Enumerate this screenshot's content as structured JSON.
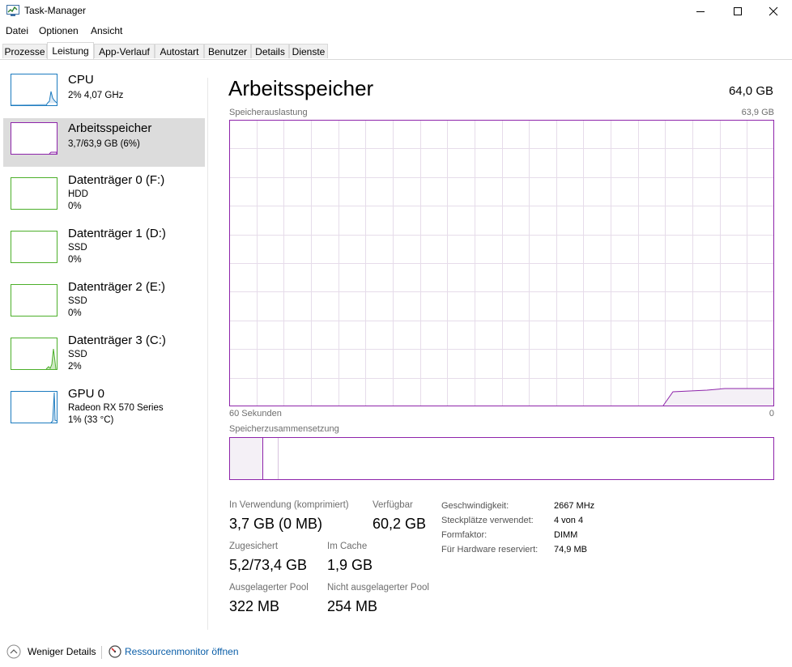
{
  "window": {
    "title": "Task-Manager"
  },
  "menu": [
    "Datei",
    "Optionen",
    "Ansicht"
  ],
  "tabs": [
    "Prozesse",
    "Leistung",
    "App-Verlauf",
    "Autostart",
    "Benutzer",
    "Details",
    "Dienste"
  ],
  "active_tab": "Leistung",
  "sidebar": {
    "items": [
      {
        "title": "CPU",
        "line1": "2% 4,07 GHz",
        "line2": "",
        "color": "#1c7bbf"
      },
      {
        "title": "Arbeitsspeicher",
        "line1": "3,7/63,9 GB (6%)",
        "line2": "",
        "color": "#8e24aa"
      },
      {
        "title": "Datenträger 0 (F:)",
        "line1": "HDD",
        "line2": "0%",
        "color": "#4caf2a"
      },
      {
        "title": "Datenträger 1 (D:)",
        "line1": "SSD",
        "line2": "0%",
        "color": "#4caf2a"
      },
      {
        "title": "Datenträger 2 (E:)",
        "line1": "SSD",
        "line2": "0%",
        "color": "#4caf2a"
      },
      {
        "title": "Datenträger 3 (C:)",
        "line1": "SSD",
        "line2": "2%",
        "color": "#4caf2a"
      },
      {
        "title": "GPU 0",
        "line1": "Radeon RX 570 Series",
        "line2": "1% (33 °C)",
        "color": "#1c7bbf"
      }
    ]
  },
  "main": {
    "title": "Arbeitsspeicher",
    "total": "64,0 GB",
    "graph": {
      "label": "Speicherauslastung",
      "max_label": "63,9 GB",
      "x_left": "60 Sekunden",
      "x_right": "0"
    },
    "composition_label": "Speicherzusammensetzung",
    "stats": {
      "in_use_label": "In Verwendung (komprimiert)",
      "in_use_value": "3,7 GB (0 MB)",
      "available_label": "Verfügbar",
      "available_value": "60,2 GB",
      "committed_label": "Zugesichert",
      "committed_value": "5,2/73,4 GB",
      "cached_label": "Im Cache",
      "cached_value": "1,9 GB",
      "paged_label": "Ausgelagerter Pool",
      "paged_value": "322 MB",
      "nonpaged_label": "Nicht ausgelagerter Pool",
      "nonpaged_value": "254 MB"
    },
    "info": [
      {
        "label": "Geschwindigkeit:",
        "value": "2667 MHz"
      },
      {
        "label": "Steckplätze verwendet:",
        "value": "4 von 4"
      },
      {
        "label": "Formfaktor:",
        "value": "DIMM"
      },
      {
        "label": "Für Hardware reserviert:",
        "value": "74,9 MB"
      }
    ]
  },
  "footer": {
    "fewer_details": "Weniger Details",
    "resource_monitor": "Ressourcenmonitor öffnen"
  },
  "colors": {
    "memory": "#8e24aa",
    "memory_fill": "#f4f0f6",
    "grid": "#e6dcea",
    "link": "#0a5ea8"
  }
}
